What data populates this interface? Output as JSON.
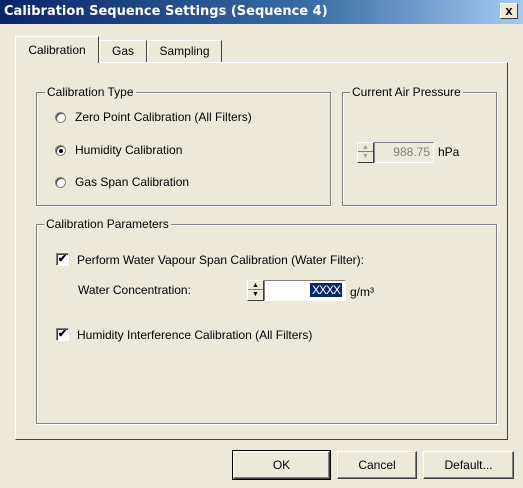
{
  "window": {
    "title": "Calibration Sequence Settings (Sequence 4)",
    "close_glyph": "x"
  },
  "tabs": [
    {
      "label": "Calibration",
      "active": true
    },
    {
      "label": "Gas",
      "active": false
    },
    {
      "label": "Sampling",
      "active": false
    }
  ],
  "calibration_type": {
    "legend": "Calibration Type",
    "options": [
      {
        "label": "Zero Point Calibration (All Filters)",
        "selected": false
      },
      {
        "label": "Humidity Calibration",
        "selected": true
      },
      {
        "label": "Gas Span Calibration",
        "selected": false
      }
    ]
  },
  "air_pressure": {
    "legend": "Current Air Pressure",
    "value": "988.75",
    "unit": "hPa",
    "enabled": false
  },
  "calibration_parameters": {
    "legend": "Calibration Parameters",
    "water_vapour_span": {
      "label": "Perform Water Vapour Span Calibration (Water Filter):",
      "checked": true
    },
    "water_concentration": {
      "label": "Water Concentration:",
      "value": "XXXX",
      "unit": "g/m³"
    },
    "humidity_interference": {
      "label": "Humidity Interference Calibration (All Filters)",
      "checked": true
    }
  },
  "buttons": {
    "ok": "OK",
    "cancel": "Cancel",
    "default": "Default..."
  },
  "icons": {
    "check_glyph": "✔",
    "spin_up": "▲",
    "spin_down": "▼"
  }
}
